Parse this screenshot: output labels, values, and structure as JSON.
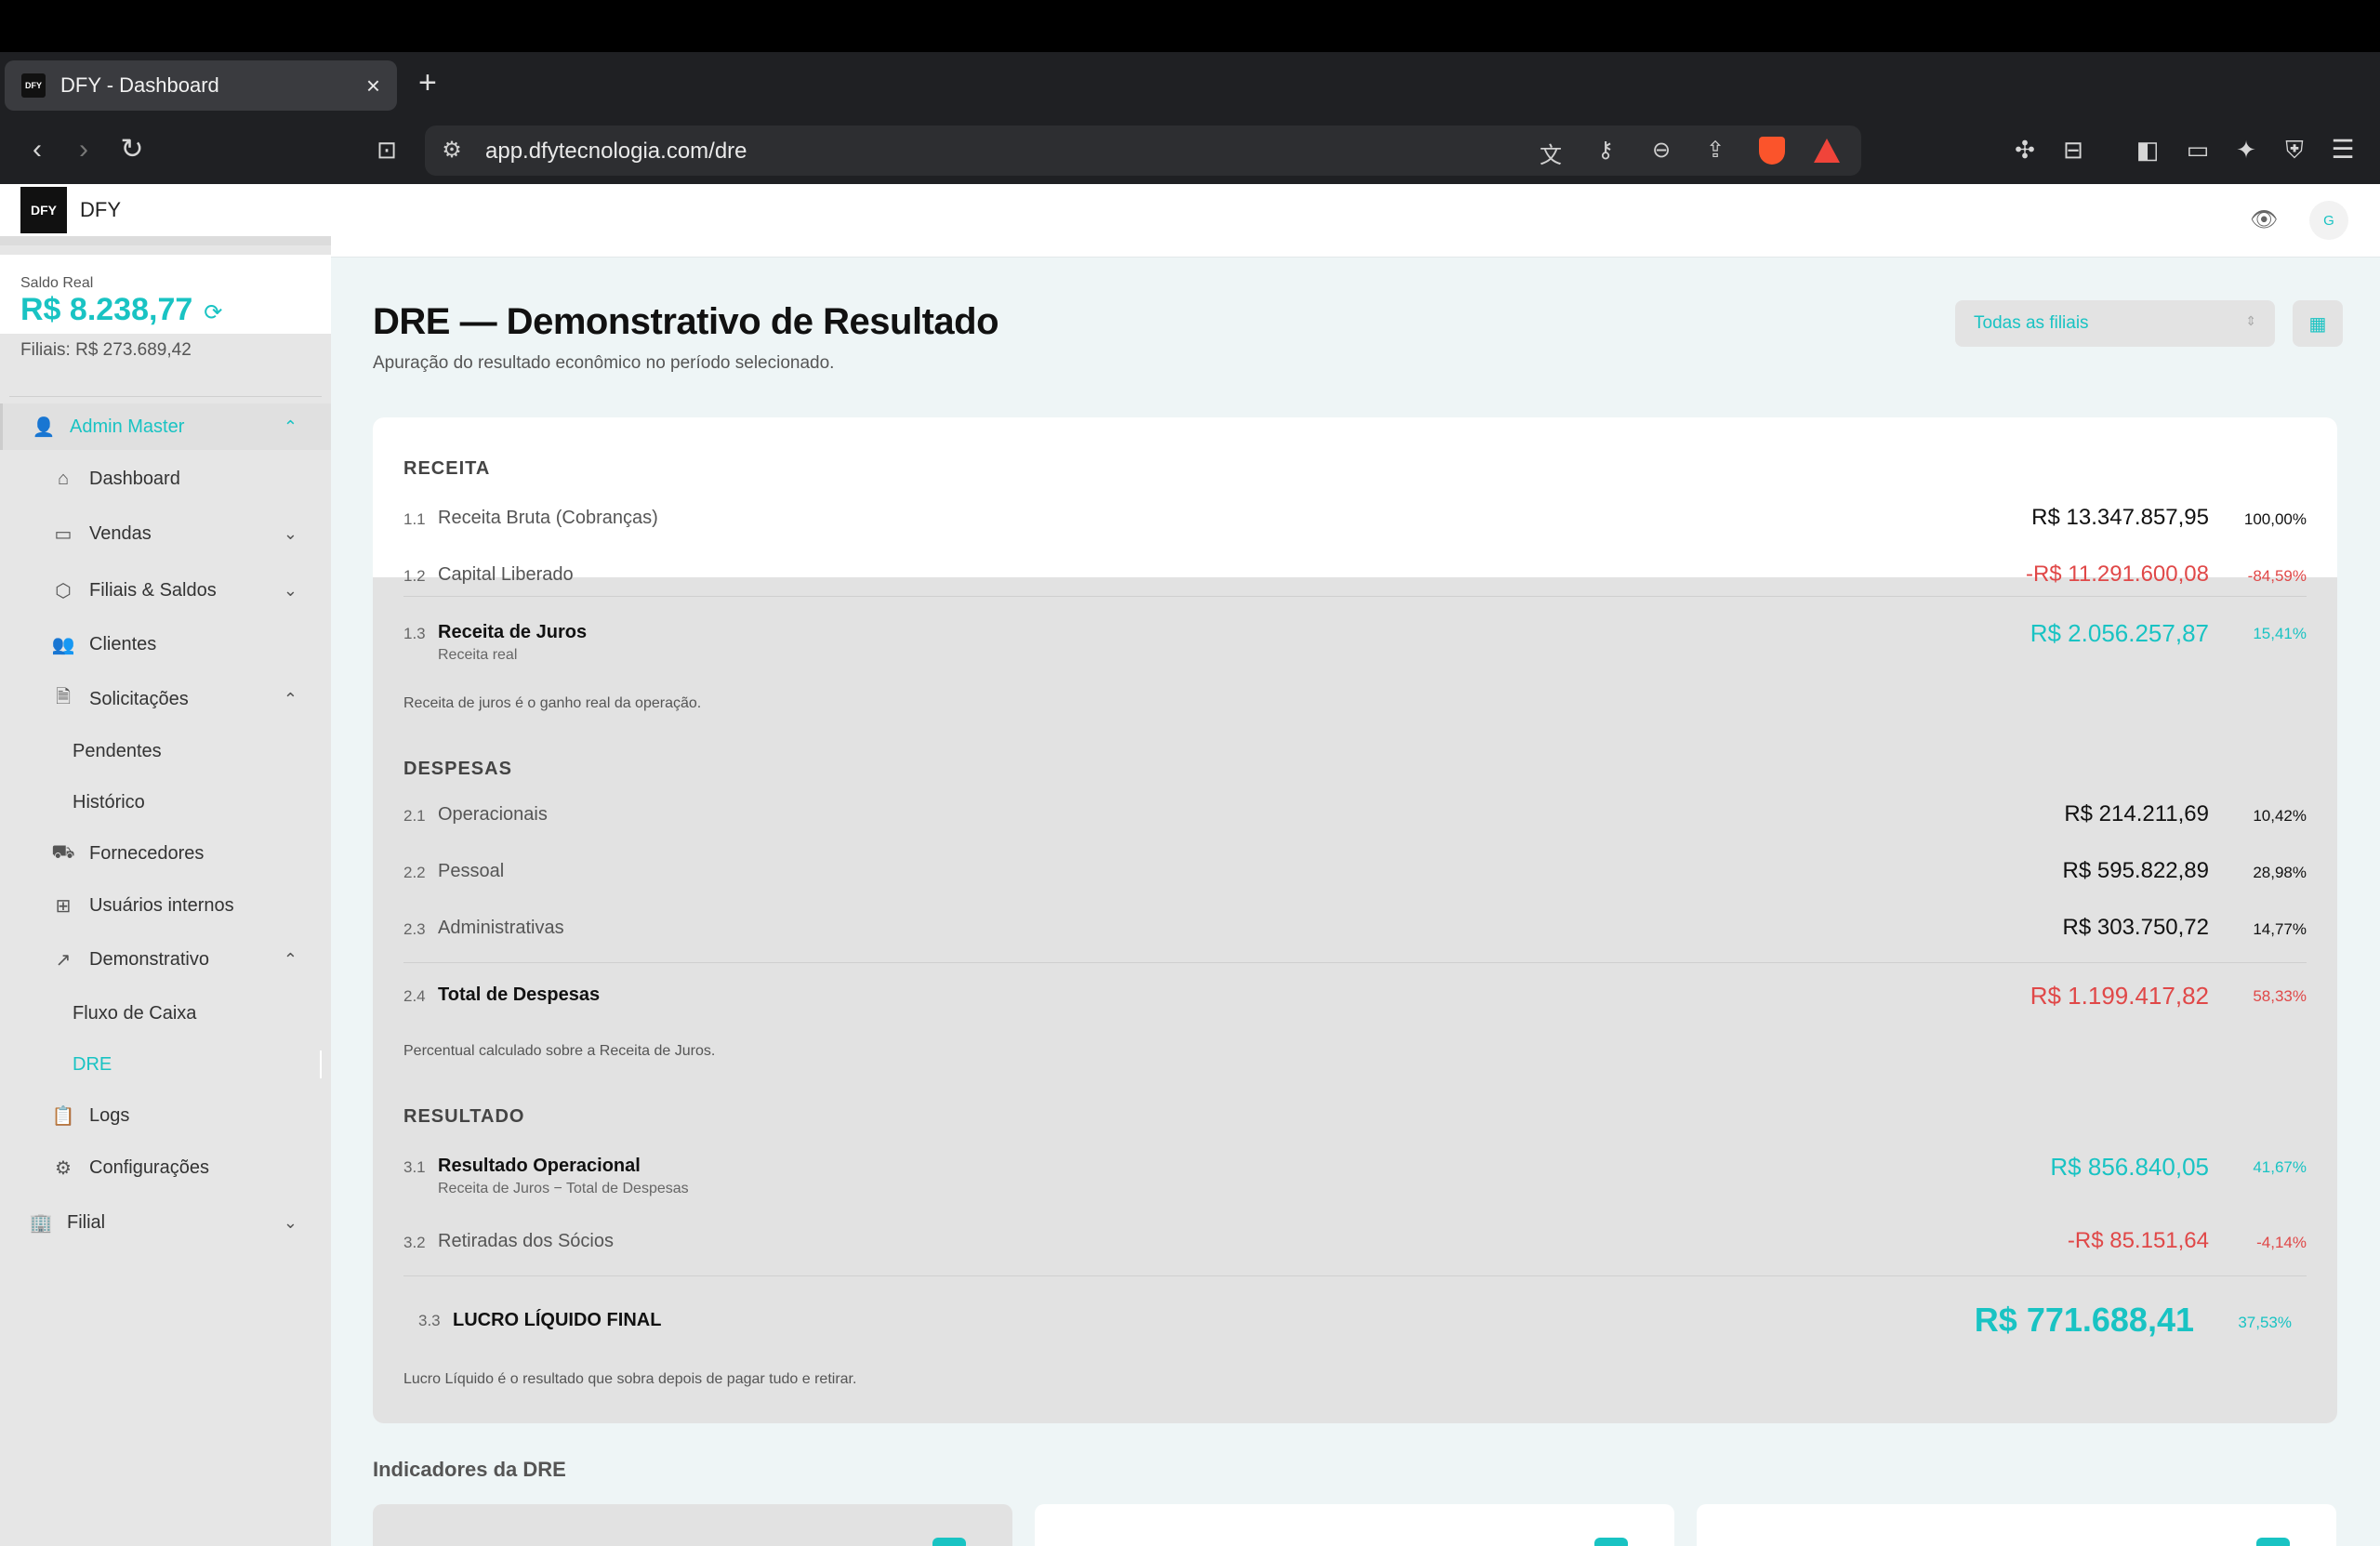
{
  "browser": {
    "tab_title": "DFY - Dashboard",
    "tab_close": "×",
    "new_tab": "+",
    "url": "app.dfytecnologia.com/dre",
    "favicon_text": "DFY"
  },
  "sidebar": {
    "brand": "DFY",
    "logo_text": "DFY",
    "saldo_label": "Saldo Real",
    "saldo_value": "R$ 8.238,77",
    "filiais_text": "Filiais: R$ 273.689,42",
    "items": [
      {
        "label": "Admin Master",
        "icon": "user-icon"
      },
      {
        "label": "Dashboard",
        "icon": "home-icon"
      },
      {
        "label": "Vendas",
        "icon": "card-icon"
      },
      {
        "label": "Filiais & Saldos",
        "icon": "box-icon"
      },
      {
        "label": "Clientes",
        "icon": "users-icon"
      },
      {
        "label": "Solicitações",
        "icon": "file-icon"
      },
      {
        "label": "Pendentes"
      },
      {
        "label": "Histórico"
      },
      {
        "label": "Fornecedores",
        "icon": "truck-icon"
      },
      {
        "label": "Usuários internos",
        "icon": "briefcase-icon"
      },
      {
        "label": "Demonstrativo",
        "icon": "trend-icon"
      },
      {
        "label": "Fluxo de Caixa"
      },
      {
        "label": "DRE"
      },
      {
        "label": "Logs",
        "icon": "clipboard-icon"
      },
      {
        "label": "Configurações",
        "icon": "gear-icon"
      },
      {
        "label": "Filial",
        "icon": "building-icon"
      }
    ]
  },
  "header": {
    "avatar": "G"
  },
  "page": {
    "title": "DRE — Demonstrativo de Resultado",
    "subtitle": "Apuração do resultado econômico no período selecionado.",
    "filter": "Todas as filiais"
  },
  "dre": {
    "receita": {
      "title": "RECEITA",
      "rows": [
        {
          "num": "1.1",
          "label": "Receita Bruta (Cobranças)",
          "amount": "R$ 13.347.857,95",
          "pct": "100,00%"
        },
        {
          "num": "1.2",
          "label": "Capital Liberado",
          "amount": "-R$ 11.291.600,08",
          "pct": "-84,59%"
        },
        {
          "num": "1.3",
          "label": "Receita de Juros",
          "sub": "Receita real",
          "amount": "R$ 2.056.257,87",
          "pct": "15,41%"
        }
      ],
      "note": "Receita de juros é o ganho real da operação."
    },
    "despesas": {
      "title": "DESPESAS",
      "rows": [
        {
          "num": "2.1",
          "label": "Operacionais",
          "amount": "R$ 214.211,69",
          "pct": "10,42%"
        },
        {
          "num": "2.2",
          "label": "Pessoal",
          "amount": "R$ 595.822,89",
          "pct": "28,98%"
        },
        {
          "num": "2.3",
          "label": "Administrativas",
          "amount": "R$ 303.750,72",
          "pct": "14,77%"
        },
        {
          "num": "2.4",
          "label": "Total de Despesas",
          "amount": "R$ 1.199.417,82",
          "pct": "58,33%"
        }
      ],
      "note": "Percentual calculado sobre a Receita de Juros."
    },
    "resultado": {
      "title": "RESULTADO",
      "rows": [
        {
          "num": "3.1",
          "label": "Resultado Operacional",
          "sub": "Receita de Juros − Total de Despesas",
          "amount": "R$ 856.840,05",
          "pct": "41,67%"
        },
        {
          "num": "3.2",
          "label": "Retiradas dos Sócios",
          "amount": "-R$ 85.151,64",
          "pct": "-4,14%"
        },
        {
          "num": "3.3",
          "label": "LUCRO LÍQUIDO FINAL",
          "amount": "R$ 771.688,41",
          "pct": "37,53%"
        }
      ],
      "note": "Lucro Líquido é o resultado que sobra depois de pagar tudo e retirar."
    }
  },
  "indicators_title": "Indicadores da DRE",
  "colors": {
    "accent": "#19c3c3",
    "negative": "#e04848"
  }
}
